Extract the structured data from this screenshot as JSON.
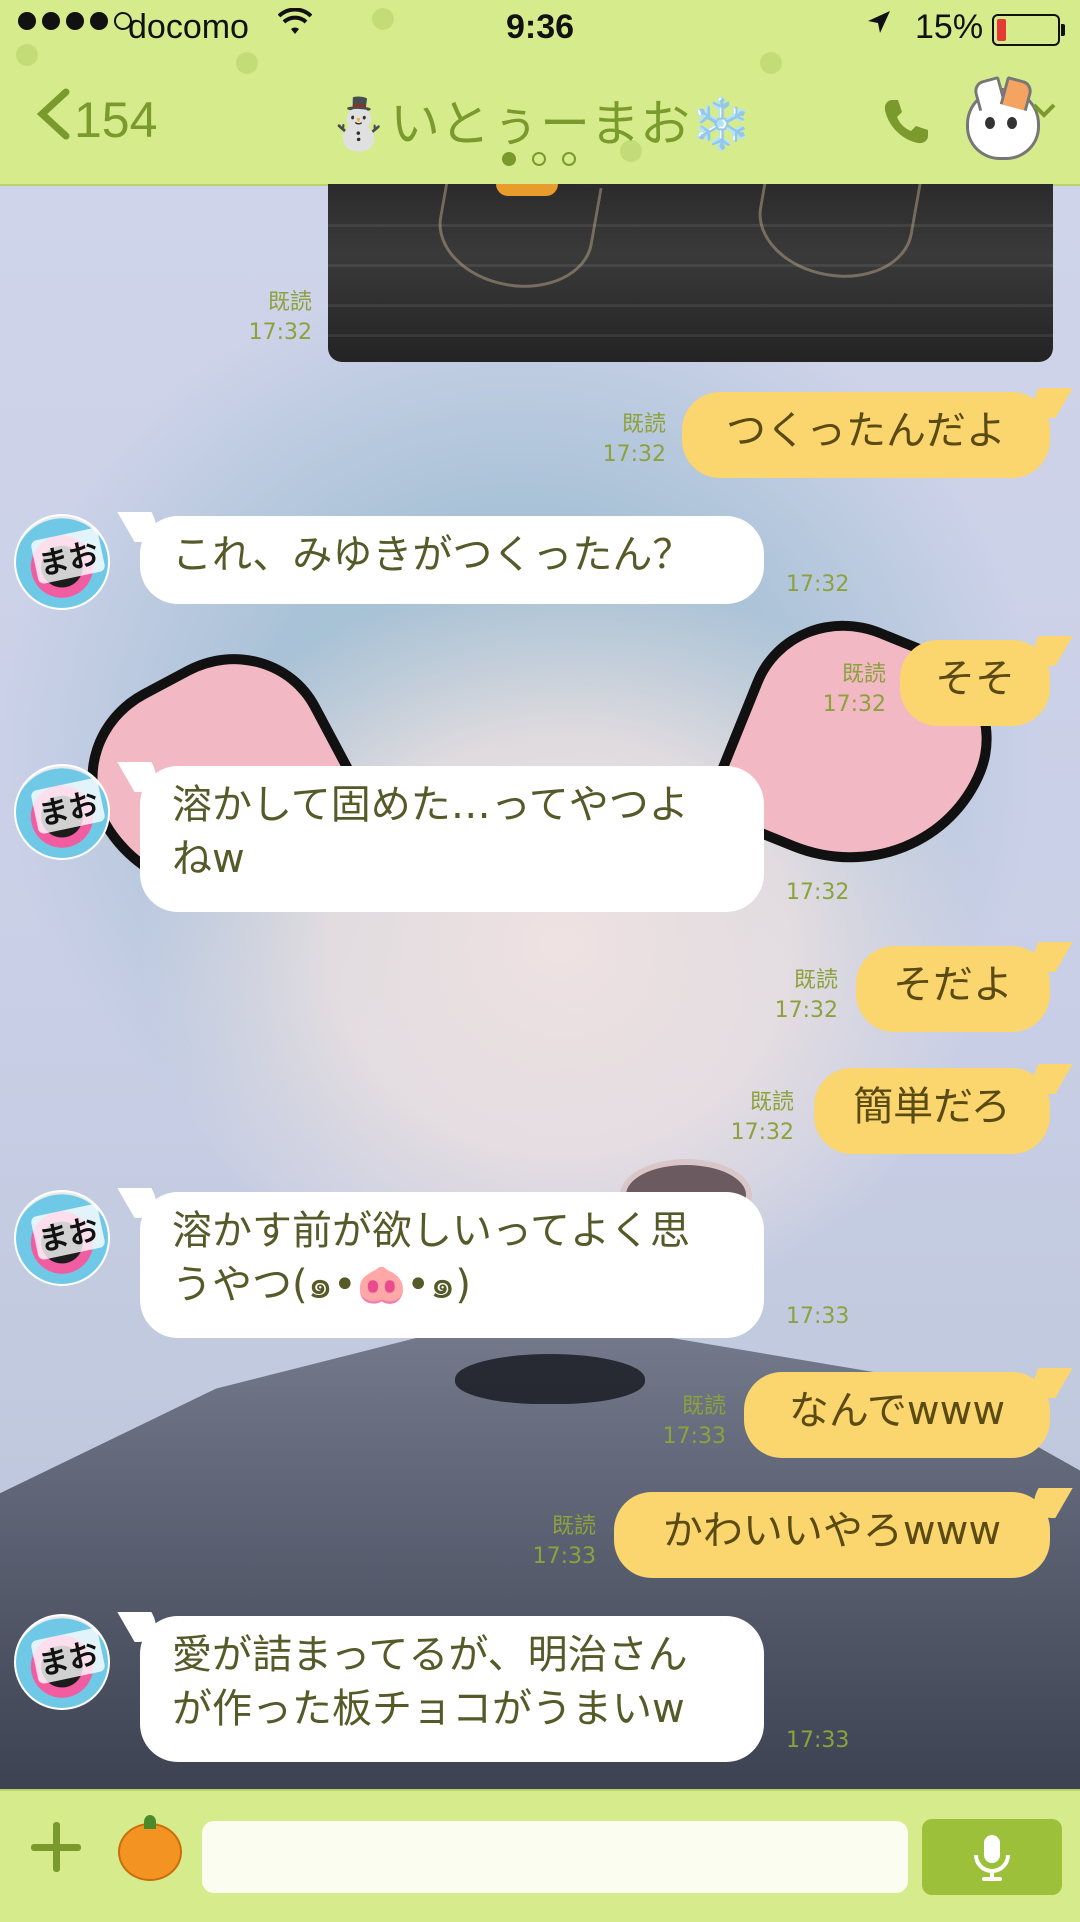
{
  "status_bar": {
    "carrier": "docomo",
    "time": "9:36",
    "battery": "15%",
    "battery_level": 0.15
  },
  "header": {
    "back_count": "154",
    "title": "⛄いとぅーまお❄️",
    "icons": [
      "chevron-left-icon",
      "phone-icon",
      "cat-profile-icon",
      "chevron-down-icon"
    ]
  },
  "colors": {
    "header_bg": "#d6ec8c",
    "accent": "#7a9a2d",
    "my_bubble": "#fbd56d",
    "their_bubble": "#ffffff",
    "send_button": "#9cc03a"
  },
  "avatar_label": "まお",
  "messages": [
    {
      "from": "me",
      "type": "image",
      "read": "既読",
      "time": "17:32"
    },
    {
      "from": "me",
      "text": "つくったんだよ",
      "read": "既読",
      "time": "17:32"
    },
    {
      "from": "them",
      "text": "これ、みゆきがつくったん？",
      "time": "17:32"
    },
    {
      "from": "me",
      "text": "そそ",
      "read": "既読",
      "time": "17:32"
    },
    {
      "from": "them",
      "text": "溶かして固めた…ってやつよ\nねw",
      "time": "17:32"
    },
    {
      "from": "me",
      "text": "そだよ",
      "read": "既読",
      "time": "17:32"
    },
    {
      "from": "me",
      "text": "簡単だろ",
      "read": "既読",
      "time": "17:32"
    },
    {
      "from": "them",
      "text": "溶かす前が欲しいってよく思\nうやつ(๑•🐽•๑)",
      "time": "17:33"
    },
    {
      "from": "me",
      "text": "なんでwww",
      "read": "既読",
      "time": "17:33"
    },
    {
      "from": "me",
      "text": "かわいいやろwww",
      "read": "既読",
      "time": "17:33"
    },
    {
      "from": "them",
      "text": "愛が詰まってるが、明治さん\nが作った板チョコがうまいw",
      "time": "17:33"
    }
  ],
  "input_bar": {
    "placeholder": "",
    "icons": [
      "plus-icon",
      "sticker-orange-icon",
      "mic-icon"
    ]
  }
}
